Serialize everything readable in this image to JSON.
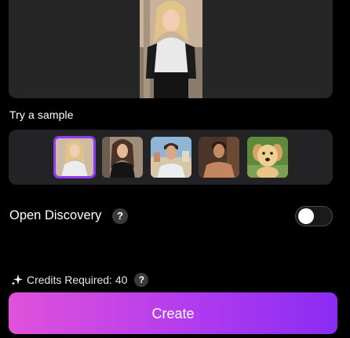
{
  "samples": {
    "title": "Try a sample",
    "items": [
      {
        "name": "blonde-woman",
        "selected": true
      },
      {
        "name": "brunette-woman",
        "selected": false
      },
      {
        "name": "man-with-coastal-town",
        "selected": false
      },
      {
        "name": "shirtless-man",
        "selected": false
      },
      {
        "name": "golden-retriever-puppy",
        "selected": false
      }
    ]
  },
  "discovery": {
    "label": "Open Discovery",
    "help": "?",
    "enabled": false
  },
  "credits": {
    "label": "Credits Required: 40",
    "help": "?"
  },
  "create_button": {
    "label": "Create"
  },
  "colors": {
    "accent": "#8e3bf5",
    "gradient_start": "#e052d9",
    "gradient_end": "#8a2cf3",
    "panel": "#262627",
    "background": "#000000"
  },
  "icons": [
    "sparkle-icon",
    "help-icon"
  ]
}
